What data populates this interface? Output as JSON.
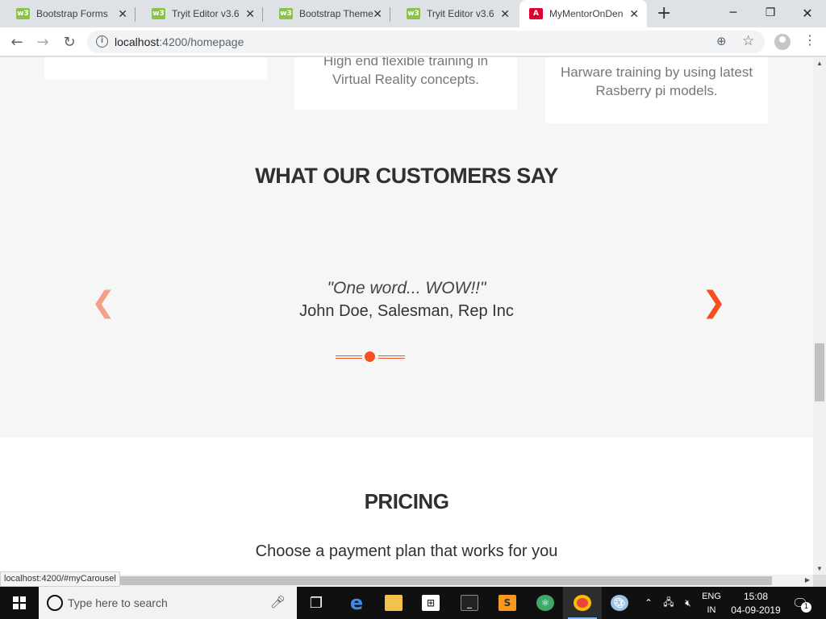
{
  "browser": {
    "tabs": [
      {
        "label": "Bootstrap Forms",
        "favicon": "w3"
      },
      {
        "label": "Tryit Editor v3.6",
        "favicon": "w3"
      },
      {
        "label": "Bootstrap Theme",
        "favicon": "w3"
      },
      {
        "label": "Tryit Editor v3.6",
        "favicon": "w3"
      },
      {
        "label": "MyMentorOnDen",
        "favicon": "A"
      }
    ],
    "close_glyph": "✕",
    "new_tab_glyph": "+",
    "window_controls": {
      "minimize": "─",
      "restore": "❐",
      "close": "✕"
    },
    "address": {
      "host": "localhost",
      "path": ":4200/homepage"
    },
    "status_url": "localhost:4200/#myCarousel"
  },
  "page": {
    "cards": [
      {
        "text": ""
      },
      {
        "text": "High end flexible training in Virtual Reality concepts."
      },
      {
        "text": "Harware training by using latest Rasberry pi models."
      }
    ],
    "testimonials": {
      "title": "WHAT OUR CUSTOMERS SAY",
      "quote": "\"One word... WOW!!\"",
      "author": "John Doe, Salesman, Rep Inc",
      "prev_glyph": "❮",
      "next_glyph": "❯",
      "slide_count": 3,
      "active_index": 1
    },
    "pricing": {
      "title": "PRICING",
      "subtitle": "Choose a payment plan that works for you"
    }
  },
  "taskbar": {
    "search_placeholder": "Type here to search",
    "tray": {
      "lang_line1": "ENG",
      "lang_line2": "IN",
      "time": "15:08",
      "date": "04-09-2019",
      "notifications": "1"
    }
  },
  "colors": {
    "accent": "#f4511e",
    "page_bg": "#f6f6f6"
  }
}
